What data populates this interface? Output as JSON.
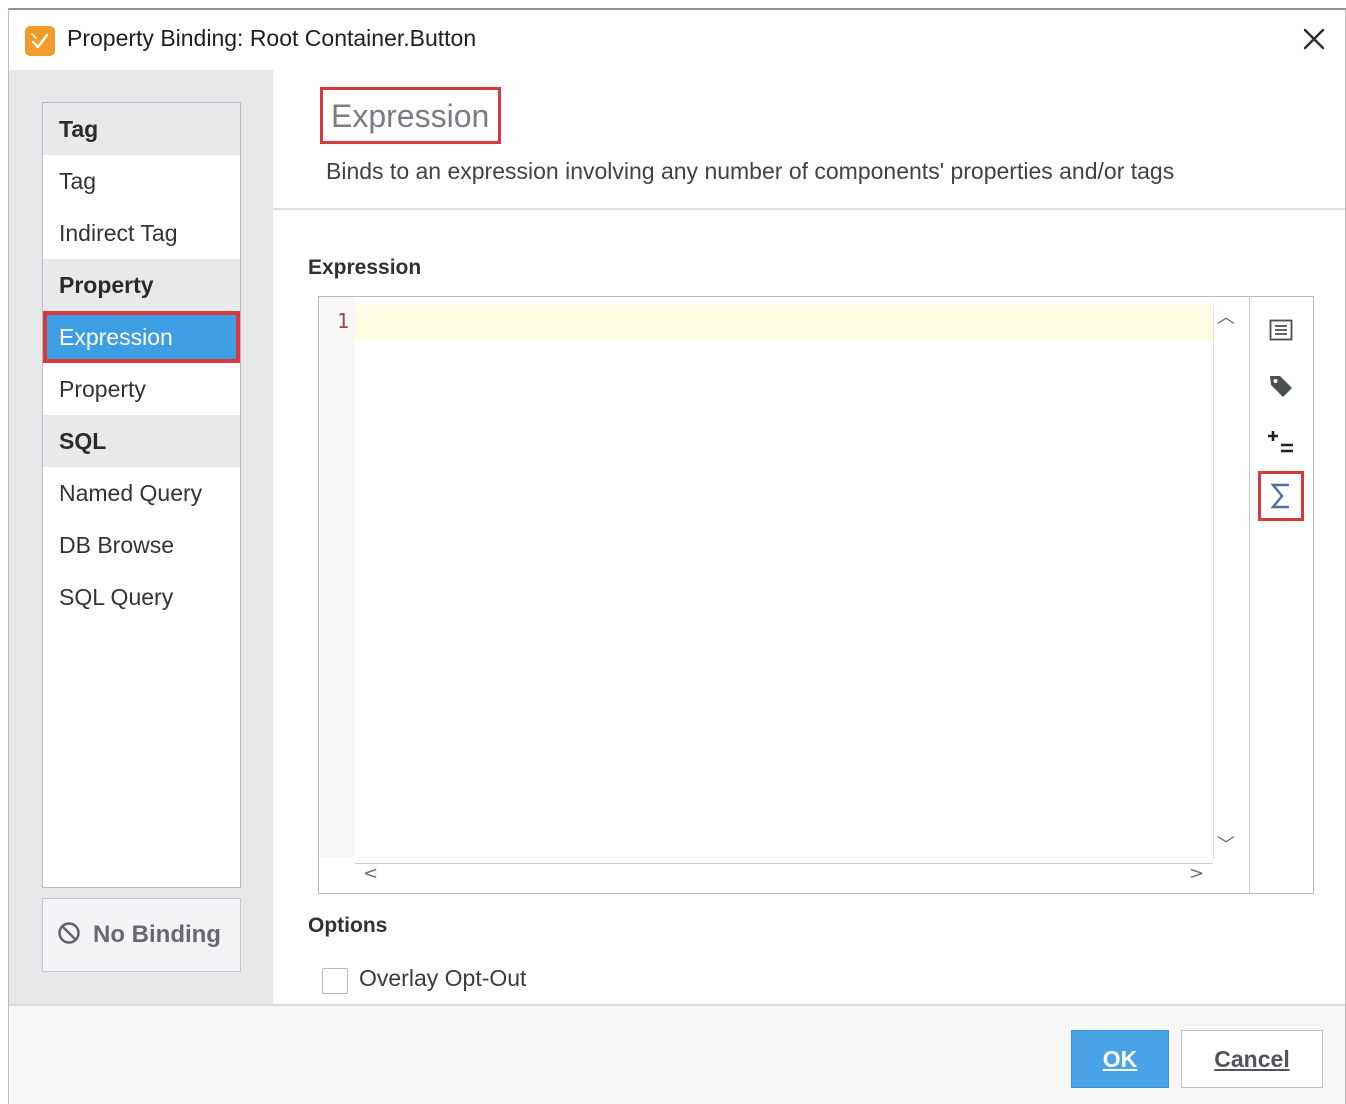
{
  "window": {
    "title": "Property Binding: Root Container.Button",
    "icon": "binding-brush-icon",
    "accent_color": "#f39b2b"
  },
  "binding_types": {
    "groups": [
      {
        "header": "Tag",
        "items": [
          "Tag",
          "Indirect Tag"
        ]
      },
      {
        "header": "Property",
        "items": [
          "Expression",
          "Property"
        ]
      },
      {
        "header": "SQL",
        "items": [
          "Named Query",
          "DB Browse",
          "SQL Query"
        ]
      }
    ],
    "selected": "Expression",
    "selection_color": "#3d9ee3",
    "no_binding_label": "No Binding"
  },
  "main": {
    "title": "Expression",
    "description": "Binds to an expression involving any number of components' properties and/or tags",
    "expression_label": "Expression",
    "editor": {
      "line_numbers": [
        "1"
      ],
      "content": ""
    },
    "toolbar_icons": [
      "property-browser-icon",
      "tag-icon",
      "operators-icon",
      "functions-sigma-icon"
    ],
    "options_label": "Options",
    "overlay_opt_out_label": "Overlay Opt-Out",
    "overlay_opt_out_checked": false
  },
  "footer": {
    "ok_label": "OK",
    "cancel_label": "Cancel"
  },
  "highlight_color": "#d8393b"
}
